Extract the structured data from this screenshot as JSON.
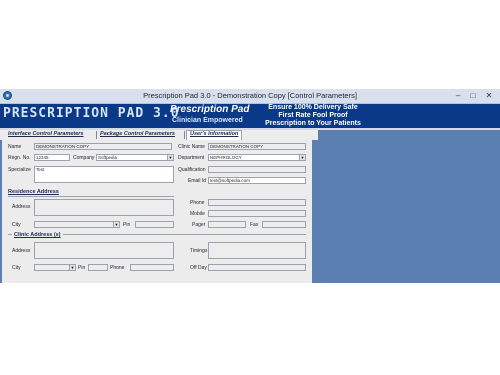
{
  "window": {
    "title": "Prescription Pad 3.0 - Demonstration Copy   [Control Parameters]",
    "minimize": "–",
    "maximize": "□",
    "close": "✕"
  },
  "banner": {
    "logo": "PRESCRIPTION PAD 3.0",
    "product": "Prescription Pad",
    "tagline": "Clinician Empowered",
    "slogan": [
      "Ensure 100% Delivery Safe",
      "First Rate Fool Proof",
      "Prescription to Your Patients"
    ]
  },
  "tabs": [
    "Interface Control Parameters",
    "Package Control Parameters",
    "User's Information"
  ],
  "form": {
    "name_label": "Name",
    "name_value": "DEMONSTRATION COPY",
    "clinic_name_label": "Clinic Name",
    "clinic_name_value": "DEMONSTRATION COPY",
    "regn_label": "Regn. No.",
    "regn_value": "12345",
    "company_label": "Company",
    "company_value": "Softpedia",
    "department_label": "Department",
    "department_value": "NEPHROLOGY",
    "specialize_label": "Specialize",
    "specialize_value": "Test",
    "qualification_label": "Qualification",
    "qualification_value": "",
    "email_label": "Email Id",
    "email_value": "test@softpedia.com"
  },
  "residence": {
    "heading": "Residence Address",
    "address_label": "Address",
    "city_label": "City",
    "pin_label": "Pin",
    "phone_label": "Phone",
    "mobile_label": "Mobile",
    "pager_label": "Pager",
    "fax_label": "Fax"
  },
  "clinic": {
    "heading": "Clinic Address (s)",
    "address_label": "Address",
    "timings_label": "Timings",
    "city_label": "City",
    "pin_label": "Pin",
    "phone_label": "Phone",
    "offday_label": "Off Day"
  }
}
